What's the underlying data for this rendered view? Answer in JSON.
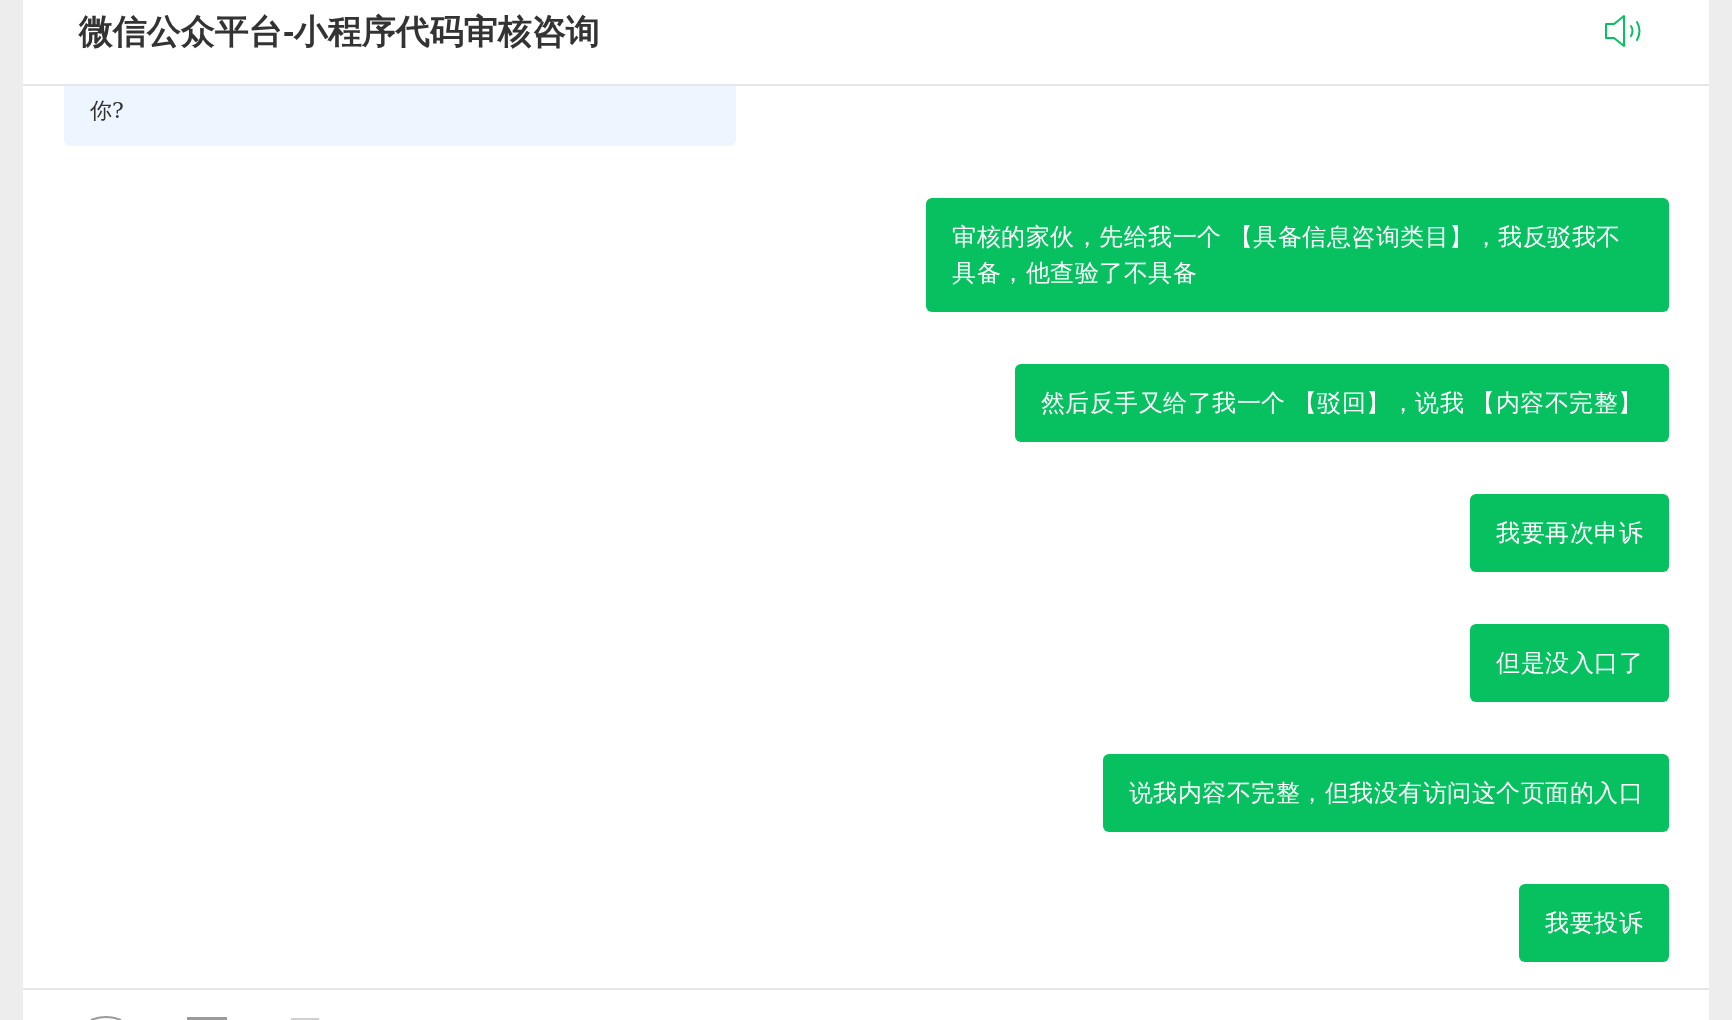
{
  "header": {
    "title": "微信公众平台-小程序代码审核咨询"
  },
  "messages": [
    {
      "kind": "received",
      "text": "你?"
    },
    {
      "kind": "sent",
      "text": "审核的家伙，先给我一个 【具备信息咨询类目】，我反驳我不具备，他查验了不具备"
    },
    {
      "kind": "sent",
      "text": "然后反手又给了我一个 【驳回】，说我 【内容不完整】"
    },
    {
      "kind": "sent",
      "text": "我要再次申诉"
    },
    {
      "kind": "sent",
      "text": "但是没入口了"
    },
    {
      "kind": "sent",
      "text": "说我内容不完整，但我没有访问这个页面的入口"
    },
    {
      "kind": "sent",
      "text": "我要投诉"
    }
  ]
}
